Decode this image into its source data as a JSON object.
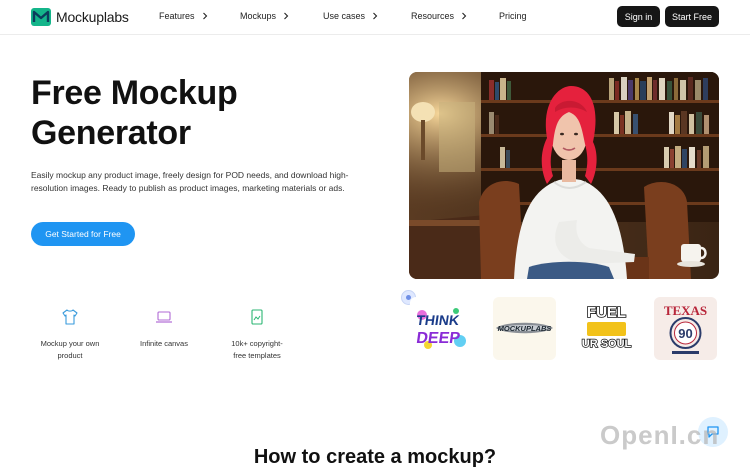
{
  "brand": {
    "name": "Mockuplabs",
    "accent": "#1f95f2",
    "logo_green": "#14b58a"
  },
  "nav": {
    "items": [
      {
        "label": "Features",
        "has_chevron": true
      },
      {
        "label": "Mockups",
        "has_chevron": true
      },
      {
        "label": "Use cases",
        "has_chevron": true
      },
      {
        "label": "Resources",
        "has_chevron": true
      },
      {
        "label": "Pricing",
        "has_chevron": false
      }
    ],
    "sign_in": "Sign in",
    "start_free": "Start Free"
  },
  "hero": {
    "title_line1": "Free Mockup",
    "title_line2": "Generator",
    "description": "Easily mockup any product image, freely design for POD needs, and download high-resolution images. Ready to publish as product images, marketing materials or ads.",
    "cta": "Get Started for Free"
  },
  "features": [
    {
      "icon": "tshirt-icon",
      "label_line1": "Mockup your own",
      "label_line2": "product"
    },
    {
      "icon": "laptop-icon",
      "label_line1": "Infinite canvas",
      "label_line2": ""
    },
    {
      "icon": "template-icon",
      "label_line1": "10k+ copyright-",
      "label_line2": "free templates"
    }
  ],
  "designs": [
    {
      "text_line1": "THINK",
      "text_line2": "DEEP"
    },
    {
      "text_line1": "MOCKUPLABS",
      "text_line2": ""
    },
    {
      "text_line1": "FUEL",
      "text_line2": "UR SOUL"
    },
    {
      "text_line1": "TEXAS",
      "text_line2": "90"
    }
  ],
  "section": {
    "title": "How to create a mockup?"
  },
  "watermark": "OpenI.cn"
}
